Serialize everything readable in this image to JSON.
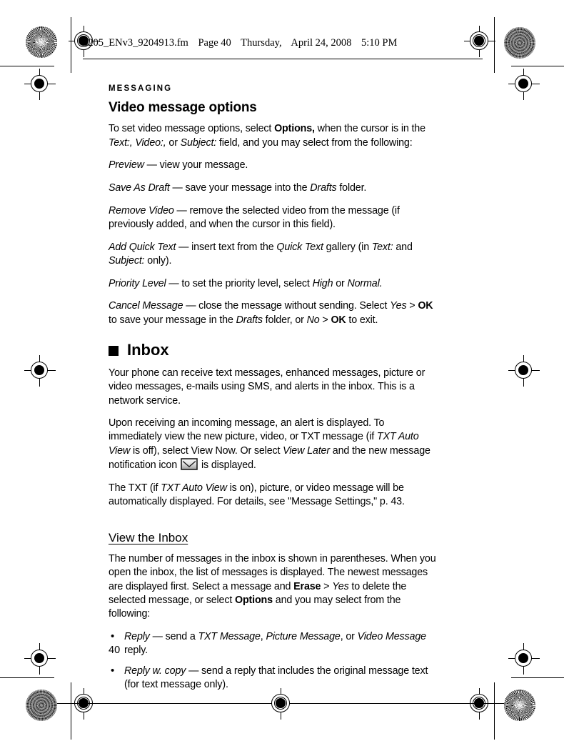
{
  "header": {
    "filename": "6205_ENv3_9204913.fm",
    "page_label": "Page 40",
    "weekday": "Thursday,",
    "date": "April 24, 2008",
    "time": "5:10 PM"
  },
  "running_head": "MESSAGING",
  "chapter_title": "Video message options",
  "paragraphs": {
    "intro_1": "To set video message options, select ",
    "intro_options": "Options,",
    "intro_2": " when the cursor is in the ",
    "intro_text_field": "Text:,",
    "intro_3": " ",
    "intro_video_field": "Video:,",
    "intro_4": " or ",
    "intro_subject_field": "Subject:",
    "intro_5": " field, and you may select from the following:",
    "preview_term": "Preview",
    "preview_desc": " — view your message.",
    "save_term": "Save As Draft",
    "save_desc_1": " — save your message into the ",
    "save_drafts": "Drafts",
    "save_desc_2": " folder.",
    "remove_term": "Remove Video",
    "remove_desc": " — remove the selected video from the message (if previously added, and when the cursor in this field).",
    "quick_term": "Add Quick Text",
    "quick_desc_1": " — insert text from the ",
    "quick_gallery": "Quick Text",
    "quick_desc_2": " gallery (in ",
    "quick_text_field": "Text:",
    "quick_desc_3": " and ",
    "quick_subject_field": "Subject:",
    "quick_desc_4": " only).",
    "priority_term": "Priority Level",
    "priority_desc_1": " — to set the priority level, select ",
    "priority_high": "High",
    "priority_desc_2": " or ",
    "priority_normal": "Normal.",
    "cancel_term": "Cancel Message",
    "cancel_desc_1": " — close the message without sending. Select ",
    "cancel_yes": "Yes",
    "cancel_gt1": " > ",
    "cancel_ok1": "OK",
    "cancel_desc_2": " to save your message in the ",
    "cancel_drafts": "Drafts",
    "cancel_desc_3": " folder, or ",
    "cancel_no": "No",
    "cancel_gt2": " > ",
    "cancel_ok2": "OK",
    "cancel_desc_4": " to exit."
  },
  "inbox_section": {
    "heading": "Inbox",
    "para_1": "Your phone can receive text messages, enhanced messages, picture or video messages, e-mails using SMS, and alerts in the inbox. This is a network service.",
    "para_2_a": "Upon receiving an incoming message, an alert is displayed. To immediately view the new picture, video, or TXT message (if ",
    "para_2_autoview": "TXT Auto View",
    "para_2_b": " is off), select View Now. Or select ",
    "para_2_viewlater": "View Later",
    "para_2_c": " and the new message notification icon",
    "para_2_d": "is displayed.",
    "para_3_a": "The TXT (if ",
    "para_3_autoview": "TXT Auto View",
    "para_3_b": " is on), picture, or video message will be automatically displayed. For details, see \"Message Settings,\" p. 43."
  },
  "view_inbox_section": {
    "heading": "View the Inbox",
    "para_a": "The number of messages in the inbox is shown in parentheses. When you open the inbox, the list of messages is displayed. The newest messages are displayed first. Select a message and ",
    "erase": "Erase",
    "para_gt": " > ",
    "yes": "Yes",
    "para_b": " to delete the selected message, or select ",
    "options": "Options",
    "para_c": " and you may select from the following:",
    "items": [
      {
        "term": "Reply",
        "desc_1": " — send a ",
        "em_1": "TXT Message",
        "desc_2": ", ",
        "em_2": "Picture Message",
        "desc_3": ", or ",
        "em_3": "Video Message",
        "desc_4": " reply."
      },
      {
        "term": "Reply w. copy",
        "desc_1": " — send a reply that includes the original message text (for text message only).",
        "em_1": "",
        "desc_2": "",
        "em_2": "",
        "desc_3": "",
        "em_3": "",
        "desc_4": ""
      }
    ]
  },
  "page_number": "40",
  "icons": {
    "envelope": "envelope-icon"
  },
  "colors": {
    "text": "#000000",
    "page_background": "#ffffff",
    "envelope_fill_light": "#f2f2f2",
    "envelope_fill_dark": "#9a9a9a",
    "envelope_border": "#1a1a1a"
  }
}
